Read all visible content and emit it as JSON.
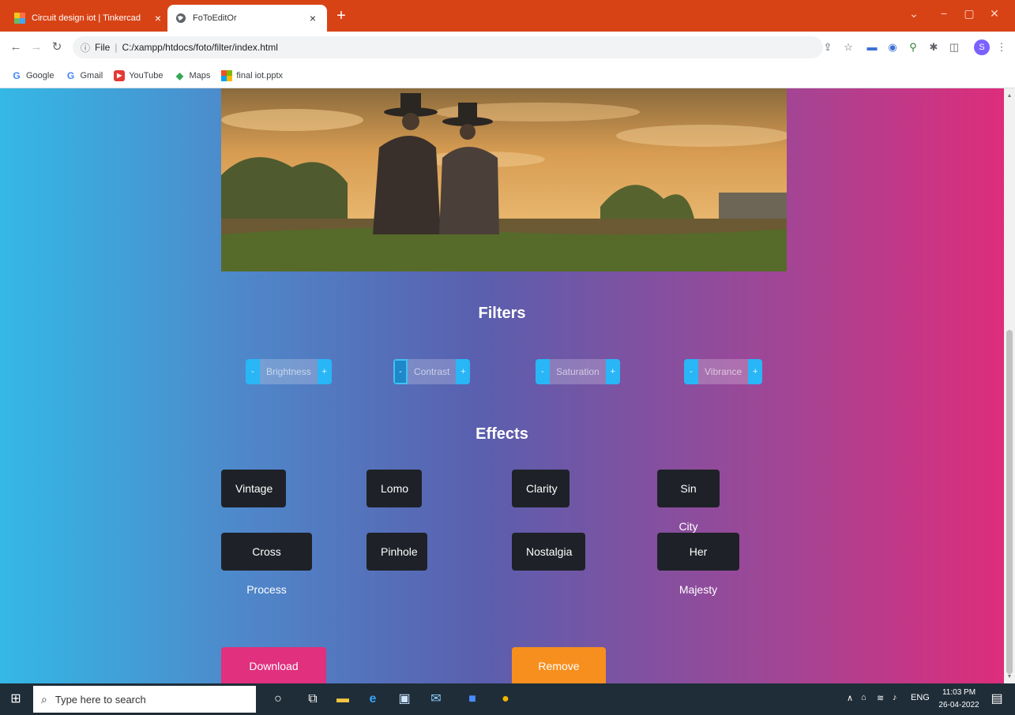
{
  "browser": {
    "tabs": [
      {
        "title": "Circuit design iot | Tinkercad",
        "active": false
      },
      {
        "title": "FoToEditOr",
        "active": true
      }
    ],
    "tab_close": "×",
    "new_tab": "+",
    "window_controls": {
      "dropdown": "⌄",
      "minimize": "−",
      "maximize": "▢",
      "close": "✕"
    },
    "address": {
      "info_label": "File",
      "url": "C:/xampp/htdocs/foto/filter/index.html"
    },
    "profile_initial": "S",
    "bookmarks": [
      {
        "label": "Google",
        "icon": "google-icon"
      },
      {
        "label": "Gmail",
        "icon": "google-icon"
      },
      {
        "label": "YouTube",
        "icon": "youtube-icon"
      },
      {
        "label": "Maps",
        "icon": "maps-icon"
      },
      {
        "label": "final iot.pptx",
        "icon": "pptx-icon"
      }
    ]
  },
  "page": {
    "filters_title": "Filters",
    "filters": [
      {
        "label": "Brightness",
        "minus": "-",
        "plus": "+"
      },
      {
        "label": "Contrast",
        "minus": "-",
        "plus": "+"
      },
      {
        "label": "Saturation",
        "minus": "-",
        "plus": "+"
      },
      {
        "label": "Vibrance",
        "minus": "-",
        "plus": "+"
      }
    ],
    "effects_title": "Effects",
    "effects": [
      "Vintage",
      "Lomo",
      "Clarity",
      "Sin City",
      "Cross Process",
      "Pinhole",
      "Nostalgia",
      "Her Majesty"
    ],
    "actions": {
      "download": "Download Image",
      "remove": "Remove Filters"
    },
    "colors": {
      "gradient_left": "#34b8e5",
      "gradient_right": "#dd2d7b",
      "effect_bg": "#1e2228",
      "download_bg": "#e0307e",
      "remove_bg": "#f78f1e",
      "filter_step_bg": "#29b6f6"
    }
  },
  "taskbar": {
    "search_placeholder": "Type here to search",
    "time": "11:03 PM",
    "date": "26-04-2022",
    "language": "ENG"
  }
}
